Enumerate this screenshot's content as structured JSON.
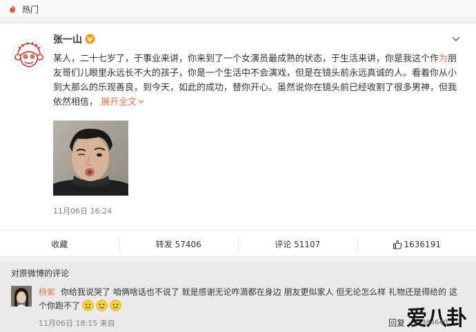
{
  "top_bar": {
    "label": "热门"
  },
  "post": {
    "author": "张一山",
    "text_before_highlight": "某人，二十七岁了，于事业来讲，你来到了一个女演员最成熟的状态，于生活来讲，你是我这个作",
    "highlight": "为",
    "text_after_highlight": "朋友哥们儿眼里永远长不大的孩子，你是一个生活中不会演戏，但是在镜头前永远真诚的人。看着你从小到大那么的乐观善良，到今天，如此的成功，替你开心。虽然说你在镜头前已经收割了很多男神，但我依然相信，",
    "expand_label": "展开全文",
    "timestamp": "11月06日 16:24"
  },
  "actions": {
    "favorite": "收藏",
    "repost": "转发 57406",
    "comment": "评论 51107",
    "like_count": "1636191"
  },
  "comments": {
    "title": "对原微博的评论",
    "items": [
      {
        "user": "杨紫",
        "text": "你给我说哭了 咱俩啥话也不说了 就是感谢无论咋滴都在身边 朋友更似家人 但无论怎么样 礼物还是得给的 这个你跑不了",
        "emoji_count": 3,
        "time": "11月06日 18:15",
        "source": "来自",
        "reply_label": "回复"
      }
    ]
  },
  "watermark": {
    "text": "爱八卦",
    "count": "384640"
  },
  "colors": {
    "accent": "#eb7350",
    "verified": "#ff9900"
  },
  "icons": [
    "hot-icon",
    "verified-icon",
    "chevron-down-icon",
    "like-icon",
    "smile-emoji-icon"
  ]
}
